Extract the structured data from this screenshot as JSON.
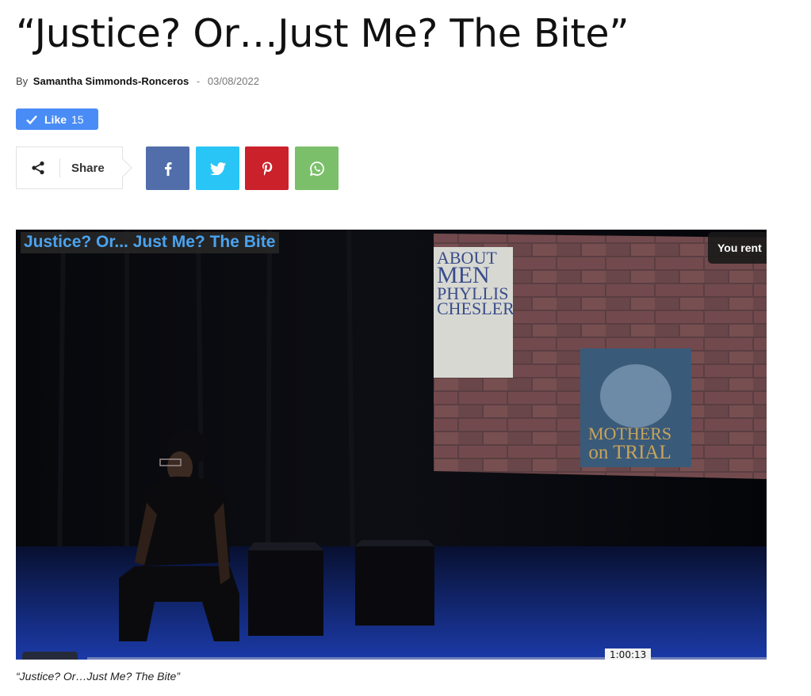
{
  "article": {
    "title": "“Justice?  Or…Just Me? The Bite”",
    "by_label": "By",
    "author": "Samantha Simmonds-Ronceros",
    "separator": "-",
    "date": "03/08/2022"
  },
  "like": {
    "label": "Like",
    "count": "15"
  },
  "share": {
    "label": "Share",
    "buttons": [
      {
        "name": "facebook",
        "icon": "facebook-icon",
        "color": "#516eab"
      },
      {
        "name": "twitter",
        "icon": "twitter-icon",
        "color": "#29c5f6"
      },
      {
        "name": "pinterest",
        "icon": "pinterest-icon",
        "color": "#ca212a"
      },
      {
        "name": "whatsapp",
        "icon": "whatsapp-icon",
        "color": "#7bbf6a"
      }
    ]
  },
  "video": {
    "overlay_title": "Justice? Or... Just Me? The Bite",
    "rent_label": "You rent",
    "duration": "1:00:13",
    "projection": {
      "book1_line1": "ABOUT",
      "book1_line2": "MEN",
      "book1_line3": "PHYLLIS",
      "book1_line4": "CHESLER",
      "book2_line1": "MOTHERS",
      "book2_line2": "on TRIAL"
    }
  },
  "caption": "“Justice?  Or…Just Me? The Bite”"
}
